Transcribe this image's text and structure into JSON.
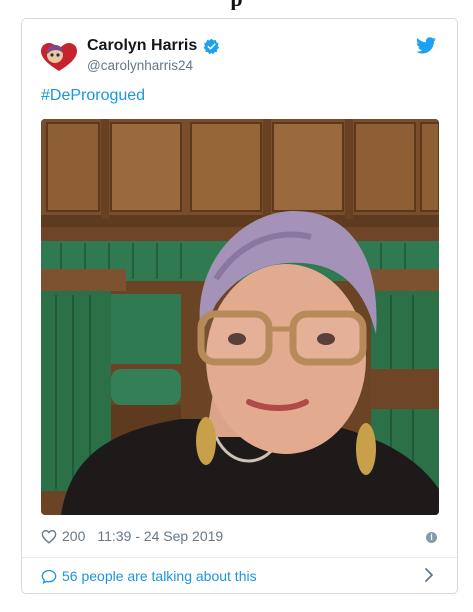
{
  "header_fragment": "p",
  "tweet": {
    "author_name": "Carolyn Harris",
    "handle": "@carolynharris24",
    "text": "#DeProrogued",
    "likes": "200",
    "timestamp": "11:39 - 24 Sep 2019",
    "conversation_text": "56 people are talking about this"
  },
  "colors": {
    "link_blue": "#1b95e0",
    "muted_text": "#657786",
    "verified_blue": "#1da1f2",
    "card_border": "#d3dbe2"
  },
  "icons": [
    "avatar",
    "verified-badge-icon",
    "twitter-bird-icon",
    "heart-icon",
    "info-icon",
    "speech-bubble-icon",
    "chevron-right-icon"
  ]
}
